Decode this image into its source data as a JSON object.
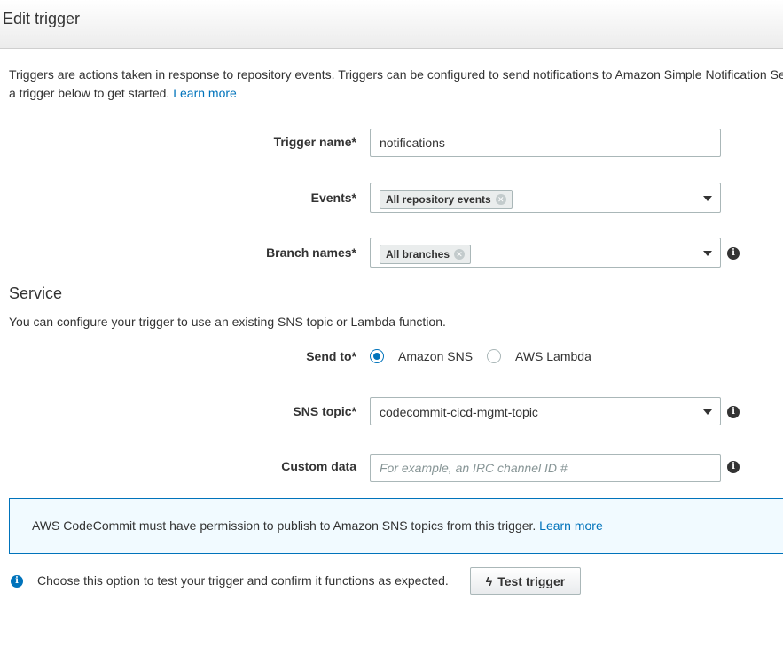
{
  "header": {
    "title": "Edit trigger"
  },
  "intro": {
    "line1": "Triggers are actions taken in response to repository events. Triggers can be configured to send notifications to Amazon Simple Notification Se",
    "line2_prefix": "a trigger below to get started.",
    "learn_more": "Learn more"
  },
  "form": {
    "trigger_name": {
      "label": "Trigger name*",
      "value": "notifications"
    },
    "events": {
      "label": "Events*",
      "tag": "All repository events"
    },
    "branch_names": {
      "label": "Branch names*",
      "tag": "All branches"
    }
  },
  "service": {
    "title": "Service",
    "description": "You can configure your trigger to use an existing SNS topic or Lambda function.",
    "send_to": {
      "label": "Send to*",
      "options": [
        "Amazon SNS",
        "AWS Lambda"
      ],
      "selected": "Amazon SNS"
    },
    "sns_topic": {
      "label": "SNS topic*",
      "value": "codecommit-cicd-mgmt-topic"
    },
    "custom_data": {
      "label": "Custom data",
      "placeholder": "For example, an IRC channel ID #"
    }
  },
  "notice": {
    "text": "AWS CodeCommit must have permission to publish to Amazon SNS topics from this trigger.",
    "learn_more": "Learn more"
  },
  "test": {
    "text": "Choose this option to test your trigger and confirm it functions as expected.",
    "button_label": "Test trigger"
  },
  "colors": {
    "accent": "#0073bb",
    "notice_bg": "#f1faff"
  }
}
